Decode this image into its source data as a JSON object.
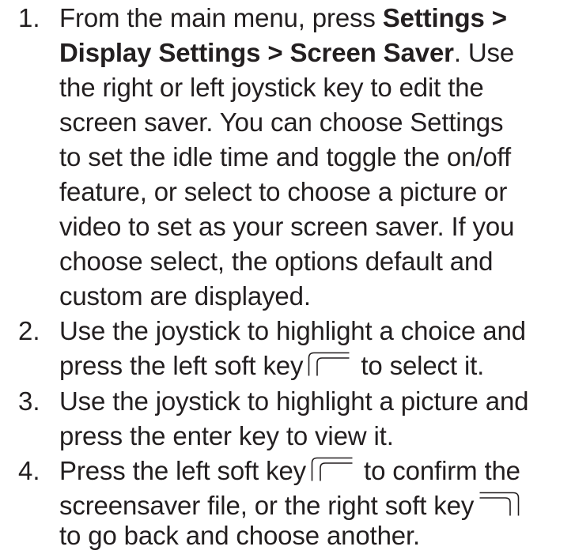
{
  "steps": [
    {
      "number": "1.",
      "lines": [
        {
          "t1": "From the main menu, press ",
          "b1": "Settings >"
        },
        {
          "b1": "Display Settings > Screen Saver",
          "t1": ". Use"
        },
        {
          "t1": "the right or left joystick key to edit the"
        },
        {
          "t1": "screen saver. You can choose Settings"
        },
        {
          "t1": "to set the idle time and toggle the on/off"
        },
        {
          "t1": "feature, or select to choose a picture or"
        },
        {
          "t1": "video to set as your screen saver. If you"
        },
        {
          "t1": "choose select, the options default and"
        },
        {
          "t1": "custom are displayed."
        }
      ]
    },
    {
      "number": "2.",
      "lines": [
        {
          "t1": "Use the joystick to highlight a choice and"
        },
        {
          "t1": "press the left soft key",
          "t2": " to select it."
        }
      ]
    },
    {
      "number": "3.",
      "lines": [
        {
          "t1": "Use the joystick to highlight a picture and"
        },
        {
          "t1": "press the enter key to view it."
        }
      ]
    },
    {
      "number": "4.",
      "lines": [
        {
          "t1": "Press the left soft key",
          "t2": " to confirm the"
        },
        {
          "t1": "screensaver file, or the right soft key"
        },
        {
          "t1": "to go back and choose another."
        }
      ]
    }
  ],
  "icons": {
    "left_soft_key": "left-soft-key-icon",
    "right_soft_key": "right-soft-key-icon"
  }
}
